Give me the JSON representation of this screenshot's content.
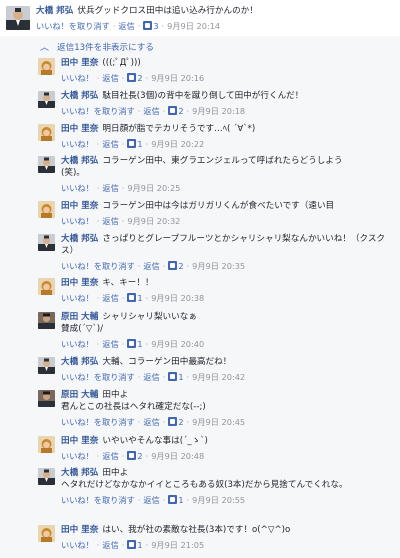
{
  "thread_top": {
    "author": "大橋 邦弘",
    "text": "伏兵グッドクロス田中は追い込み行かんのか！",
    "actions": [
      "いいね！を取り消す",
      "返信"
    ],
    "likes": "3",
    "time": "9月9日 20:14"
  },
  "hide_replies": "返信13件を非表示にする",
  "reply_labels": {
    "like": "いいね！",
    "unlike": "いいね！を取り消す",
    "reply": "返信",
    "dot": "·"
  },
  "replies": [
    {
      "author": "田中 里奈",
      "avatar": "blonde",
      "lines": [
        "(((;ﾟДﾟ)))"
      ],
      "liked": false,
      "likes": "2",
      "time": "9月9日 20:16"
    },
    {
      "author": "大橋 邦弘",
      "avatar": "suit",
      "lines": [
        "駄目社長(3個)の背中を蹴り倒して田中が行くんだ！"
      ],
      "liked": true,
      "likes": "2",
      "time": "9月9日 20:18"
    },
    {
      "author": "田中 里奈",
      "avatar": "blonde",
      "lines": [
        "明日顔が脂でテカリそうです…ﾍ( ´∀`*)"
      ],
      "liked": false,
      "likes": "1",
      "time": "9月9日 20:22"
    },
    {
      "author": "大橋 邦弘",
      "avatar": "suit",
      "lines": [
        "コラーゲン田中、東グラエンジェルって呼ばれたらどうしよう",
        "(笑)。"
      ],
      "liked": false,
      "likes": "",
      "time": "9月9日 20:25"
    },
    {
      "author": "田中 里奈",
      "avatar": "blonde",
      "lines": [
        "コラーゲン田中は今はガリガリくんが食べたいです（遠い目"
      ],
      "liked": false,
      "likes": "",
      "time": "9月9日 20:32"
    },
    {
      "author": "大橋 邦弘",
      "avatar": "suit",
      "lines": [
        "さっぱりとグレープフルーツとかシャリシャリ梨なんかいいね！（クスクス）"
      ],
      "liked": true,
      "likes": "2",
      "time": "9月9日 20:35"
    },
    {
      "author": "田中 里奈",
      "avatar": "blonde",
      "lines": [
        "キ、キー！！"
      ],
      "liked": false,
      "likes": "1",
      "time": "9月9日 20:38"
    },
    {
      "author": "原田 大輔",
      "avatar": "dark",
      "lines": [
        "シャリシャリ梨いいなぁ",
        "賛成(´▽`)/"
      ],
      "liked": false,
      "likes": "1",
      "time": "9月9日 20:40"
    },
    {
      "author": "大橋 邦弘",
      "avatar": "suit",
      "lines": [
        "大輔、コラーゲン田中最高だね！"
      ],
      "liked": true,
      "likes": "1",
      "time": "9月9日 20:42"
    },
    {
      "author": "原田 大輔",
      "avatar": "dark",
      "lines": [
        "田中よ",
        "君んとこの社長はヘタれ確定だな(--;)"
      ],
      "liked": true,
      "likes": "2",
      "time": "9月9日 20:45"
    },
    {
      "author": "田中 里奈",
      "avatar": "blonde",
      "lines": [
        "いやいやそんな事は(´_ゝ`)"
      ],
      "liked": false,
      "likes": "2",
      "time": "9月9日 20:48"
    },
    {
      "author": "大橋 邦弘",
      "avatar": "suit",
      "lines": [
        "田中よ",
        "ヘタれだけどなかなかイイところもある奴(3本)だから見捨てんでくれな。"
      ],
      "liked": true,
      "likes": "1",
      "time": "9月9日 20:55"
    },
    {
      "author": "田中 里奈",
      "avatar": "blonde",
      "lines": [
        "はい、我が社の素敵な社長(3本)です！o(^▽^)o"
      ],
      "liked": false,
      "likes": "1",
      "time": "9月9日 21:05"
    }
  ],
  "colors": {
    "link": "#365899",
    "action": "#4267b2",
    "meta": "#90949c",
    "bg": "#f6f7f9"
  }
}
